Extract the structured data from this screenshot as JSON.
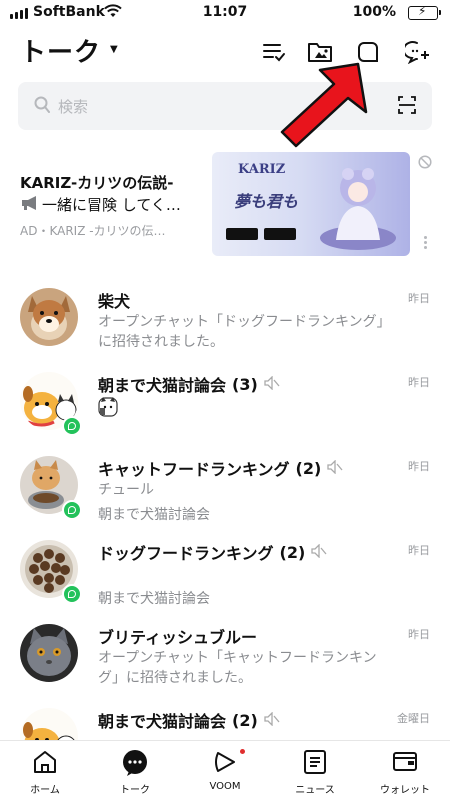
{
  "status": {
    "carrier": "SoftBank",
    "time": "11:07",
    "battery": "100%"
  },
  "header": {
    "title": "トーク"
  },
  "search": {
    "placeholder": "検索"
  },
  "ad": {
    "title": "KARIZ-カリツの伝説-",
    "description": "一緒に冒険 してく…",
    "meta": "AD・KARIZ -カリツの伝…",
    "banner_logo": "KARIZ",
    "banner_headline": "夢も君も"
  },
  "chats": [
    {
      "name": "柴犬",
      "count": "",
      "time": "昨日",
      "message": "オープンチャット「ドッグフードランキング」に招待されました。",
      "sub": ""
    },
    {
      "name": "朝まで犬猫討論会",
      "count": "(3)",
      "time": "昨日",
      "message": "",
      "sub": ""
    },
    {
      "name": "キャットフードランキング",
      "count": "(2)",
      "time": "昨日",
      "message": "チュール",
      "sub": "朝まで犬猫討論会"
    },
    {
      "name": "ドッグフードランキング",
      "count": "(2)",
      "time": "昨日",
      "message": "",
      "sub": "朝まで犬猫討論会"
    },
    {
      "name": "ブリティッシュブルー",
      "count": "",
      "time": "昨日",
      "message": "オープンチャット「キャットフードランキング」に招待されました。",
      "sub": ""
    },
    {
      "name": "朝まで犬猫討論会",
      "count": "(2)",
      "time": "金曜日",
      "message": "",
      "sub": ""
    }
  ],
  "nav": {
    "home": "ホーム",
    "talk": "トーク",
    "voom": "VOOM",
    "news": "ニュース",
    "wallet": "ウォレット"
  },
  "colors": {
    "accent": "#23c25b",
    "arrow": "#e8141c",
    "notice_dot": "#e02e2e"
  }
}
